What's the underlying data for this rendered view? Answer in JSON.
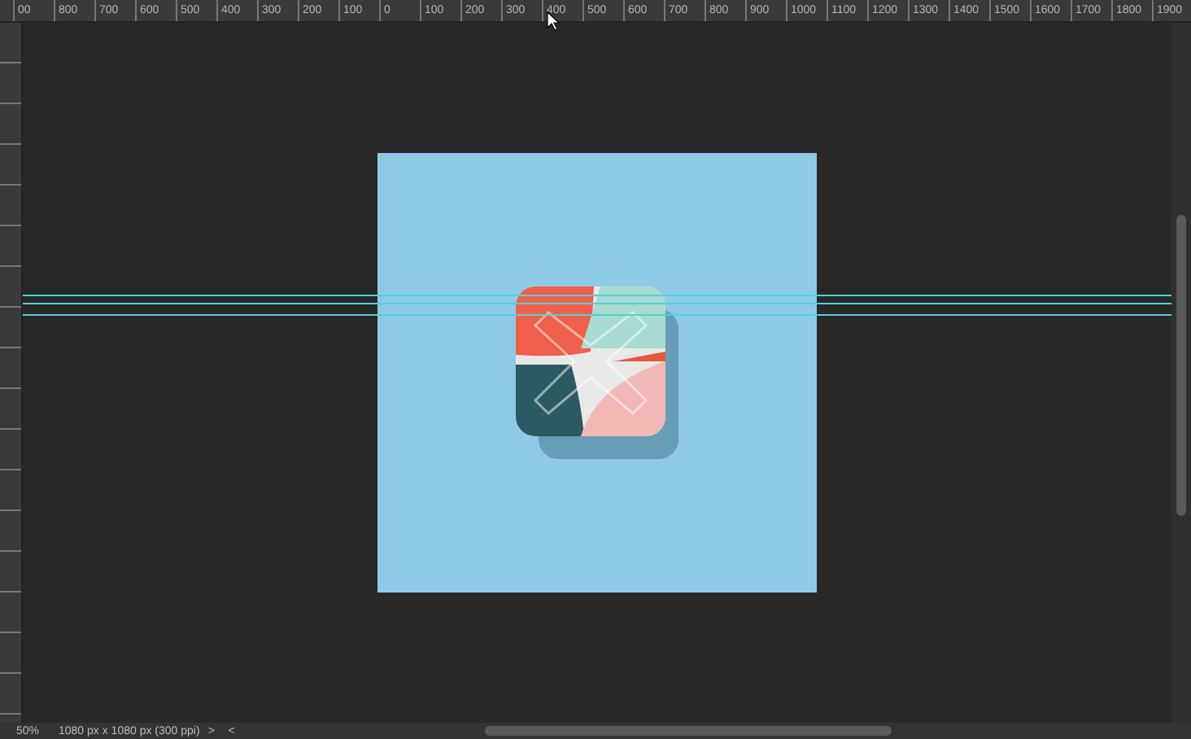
{
  "ruler": {
    "labels": [
      "00",
      "800",
      "700",
      "600",
      "500",
      "400",
      "300",
      "200",
      "100",
      "0",
      "100",
      "200",
      "300",
      "400",
      "500",
      "600",
      "700",
      "800",
      "900",
      "1000",
      "1100",
      "1200",
      "1300",
      "1400",
      "1500",
      "1600",
      "1700",
      "1800",
      "1900"
    ]
  },
  "status_bar": {
    "zoom": "50%",
    "document_size": "1080 px x 1080 px (300 ppi)",
    "next": ">",
    "previous": "<"
  }
}
